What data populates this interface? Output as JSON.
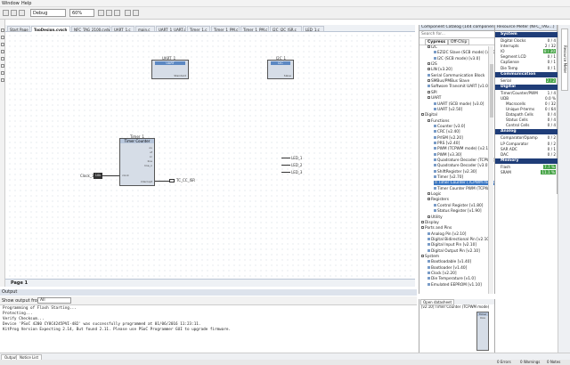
{
  "menu": {
    "items": [
      "Window",
      "Help"
    ]
  },
  "toolbar": {
    "config": "Debug",
    "zoom": "60%"
  },
  "tabs": [
    "Start Page",
    "TopDesign.cysch",
    "NFC_TAG_2100.cydwr",
    "UART_1.c",
    "main.c",
    "UART_1_UART.c",
    "Timer_1.c",
    "Timer_1_PM.c",
    "Timer_1_PM.c",
    "I2C_I2C_ISR.c",
    "LED_1.c"
  ],
  "active_tab_index": 1,
  "schematic": {
    "uart": {
      "name": "UART_1",
      "type": "UART",
      "sub": "Standard"
    },
    "i2c": {
      "name": "I2C_1",
      "type": "I2C",
      "sub": "Slave"
    },
    "timer": {
      "name": "Timer_1",
      "type": "Timer Counter",
      "pins": [
        "ov",
        "uf",
        "cc",
        "line",
        "line_n"
      ],
      "clock_pin": "clock",
      "interrupt_pin": "interrupt"
    },
    "clock": {
      "name": "Clock_1",
      "value": "10k"
    },
    "isr": {
      "name": "TC_CC_ISR"
    },
    "leds": [
      "LED_1",
      "LED_2",
      "LED_3"
    ]
  },
  "pagebar": {
    "label": "Page 1"
  },
  "output": {
    "title": "Output",
    "show_from_label": "Show output from:",
    "show_from_value": "All",
    "lines": [
      "Programming of Flash Starting...",
      "Protecting...",
      "Verify Checksum...",
      "Device 'PSoC 4200 CY8C4245PVI-482' was successfully programmed at 01/06/2016 11:23:11.",
      "KitProg Version Expecting 2.14, But found 2.11. Please use PSoC Programmer GUI to upgrade firmware."
    ]
  },
  "bottom_tabs": [
    "Output",
    "Notice List"
  ],
  "status": {
    "errors": "0 Errors",
    "warnings": "0 Warnings",
    "notes": "0 Notes"
  },
  "catalog": {
    "title": "Component Catalog (144 components)",
    "search_placeholder": "Search for...",
    "tabs": [
      "Cypress",
      "Off-Chip"
    ],
    "tree": [
      {
        "label": "I2C",
        "level": 1,
        "type": "folder"
      },
      {
        "label": "EZI2C Slave (SCB mode) [v3.0]",
        "level": 2,
        "type": "item"
      },
      {
        "label": "I2C (SCB mode) [v3.0]",
        "level": 2,
        "type": "item"
      },
      {
        "label": "I2S",
        "level": 1,
        "type": "folder"
      },
      {
        "label": "LIN [v3.20]",
        "level": 1,
        "type": "folder"
      },
      {
        "label": "Serial Communication Block",
        "level": 1,
        "type": "item"
      },
      {
        "label": "SMBus/PMBus Slave",
        "level": 1,
        "type": "folder"
      },
      {
        "label": "Software Transmit UART [v1.0]",
        "level": 1,
        "type": "item"
      },
      {
        "label": "SPI",
        "level": 1,
        "type": "folder"
      },
      {
        "label": "UART",
        "level": 1,
        "type": "folder"
      },
      {
        "label": "UART (SCB mode) [v3.0]",
        "level": 2,
        "type": "item"
      },
      {
        "label": "UART [v2.50]",
        "level": 2,
        "type": "item"
      },
      {
        "label": "Digital",
        "level": 0,
        "type": "folder"
      },
      {
        "label": "Functions",
        "level": 1,
        "type": "folder"
      },
      {
        "label": "Counter [v3.0]",
        "level": 2,
        "type": "item"
      },
      {
        "label": "CRC [v2.40]",
        "level": 2,
        "type": "item"
      },
      {
        "label": "PrISM [v2.20]",
        "level": 2,
        "type": "item"
      },
      {
        "label": "PRS [v2.40]",
        "level": 2,
        "type": "item"
      },
      {
        "label": "PWM (TCPWM mode) [v2.10]",
        "level": 2,
        "type": "item"
      },
      {
        "label": "PWM [v3.30]",
        "level": 2,
        "type": "item"
      },
      {
        "label": "Quadrature Decoder (TCPWM)",
        "level": 2,
        "type": "item"
      },
      {
        "label": "Quadrature Decoder [v3.0]",
        "level": 2,
        "type": "item"
      },
      {
        "label": "ShiftRegister [v2.30]",
        "level": 2,
        "type": "item"
      },
      {
        "label": "Timer [v2.70]",
        "level": 2,
        "type": "item"
      },
      {
        "label": "Timer Counter (TCPWM mode)",
        "level": 2,
        "type": "item",
        "selected": true
      },
      {
        "label": "Timer Counter PWM (TCPWM)",
        "level": 2,
        "type": "item"
      },
      {
        "label": "Logic",
        "level": 1,
        "type": "folder"
      },
      {
        "label": "Registers",
        "level": 1,
        "type": "folder"
      },
      {
        "label": "Control Register [v1.80]",
        "level": 2,
        "type": "item"
      },
      {
        "label": "Status Register [v1.90]",
        "level": 2,
        "type": "item"
      },
      {
        "label": "Utility",
        "level": 1,
        "type": "folder"
      },
      {
        "label": "Display",
        "level": 0,
        "type": "folder"
      },
      {
        "label": "Ports and Pins",
        "level": 0,
        "type": "folder"
      },
      {
        "label": "Analog Pin [v2.10]",
        "level": 1,
        "type": "item"
      },
      {
        "label": "Digital Bidirectional Pin [v2.10]",
        "level": 1,
        "type": "item"
      },
      {
        "label": "Digital Input Pin [v2.10]",
        "level": 1,
        "type": "item"
      },
      {
        "label": "Digital Output Pin [v2.10]",
        "level": 1,
        "type": "item"
      },
      {
        "label": "System",
        "level": 0,
        "type": "folder"
      },
      {
        "label": "Bootloadable [v1.40]",
        "level": 1,
        "type": "item"
      },
      {
        "label": "Bootloader [v1.40]",
        "level": 1,
        "type": "item"
      },
      {
        "label": "Clock [v2.20]",
        "level": 1,
        "type": "item"
      },
      {
        "label": "Die Temperature [v1.0]",
        "level": 1,
        "type": "item"
      },
      {
        "label": "Emulated EEPROM [v1.10]",
        "level": 1,
        "type": "item"
      }
    ]
  },
  "datasheet": {
    "tab": "Open datasheet",
    "title": "[v2.10] Timer Counter (TCPWM mode)",
    "box_label": "Timer Cou"
  },
  "resource_meter": {
    "title": "Resource Meter (NFC_TAG...)",
    "sections": [
      {
        "name": "System",
        "rows": [
          [
            "Digital Clocks",
            "0 / 4"
          ],
          [
            "Interrupts",
            "2 / 32"
          ],
          [
            "IO",
            "8 / 30",
            true
          ],
          [
            "Segment LCD",
            "0 / 1"
          ],
          [
            "CapSense",
            "0 / 1"
          ],
          [
            "Die Temp",
            "0 / 1"
          ]
        ]
      },
      {
        "name": "Communication",
        "rows": [
          [
            "Serial",
            "2 / 2",
            true
          ]
        ]
      },
      {
        "name": "Digital",
        "rows": [
          [
            "Timer/Counter/PWM",
            "1 / 4"
          ],
          [
            "UDB",
            "0.0 %"
          ],
          [
            "Macrocells",
            "0 / 32"
          ],
          [
            "Unique P-terms",
            "0 / 64"
          ],
          [
            "Datapath Cells",
            "0 / 4"
          ],
          [
            "Status Cells",
            "0 / 4"
          ],
          [
            "Control Cells",
            "0 / 4"
          ]
        ]
      },
      {
        "name": "Analog",
        "rows": [
          [
            "Comparator/Opamp",
            "0 / 2"
          ],
          [
            "LP Comparator",
            "0 / 2"
          ],
          [
            "SAR ADC",
            "0 / 1"
          ],
          [
            "DAC",
            "0 / 2"
          ]
        ]
      },
      {
        "name": "Memory",
        "rows": [
          [
            "Flash",
            "7.7 %",
            true
          ],
          [
            "SRAM",
            "11.1 %",
            true
          ]
        ]
      }
    ]
  },
  "right_strip": {
    "label": "Resource Meter"
  }
}
